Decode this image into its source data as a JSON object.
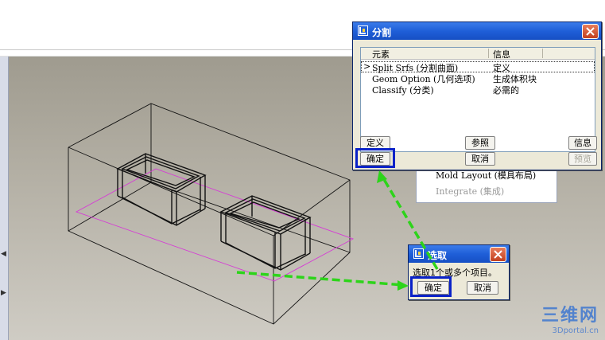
{
  "split_dialog": {
    "title": "分割",
    "columns": [
      "元素",
      "信息"
    ],
    "rows": [
      {
        "marker": ">",
        "element": "Split Srfs (分割曲面)",
        "info": "定义"
      },
      {
        "marker": "",
        "element": "Geom Option (几何选项)",
        "info": "生成体积块"
      },
      {
        "marker": "",
        "element": "Classify (分类)",
        "info": "必需的"
      }
    ],
    "buttons": {
      "define": "定义",
      "reference": "参照",
      "info": "信息",
      "ok": "确定",
      "cancel": "取消",
      "preview": "预览"
    }
  },
  "menu_behind": {
    "items": [
      "Mold Layout (模具布局)",
      "Integrate (集成)"
    ]
  },
  "select_dialog": {
    "title": "选取",
    "prompt": "选取1个或多个项目。",
    "ok": "确定",
    "cancel": "取消"
  },
  "watermark": {
    "title": "三维网",
    "url": "3Dportal.cn"
  },
  "colors": {
    "title_bar": "#1f5fd8",
    "highlight_box": "#0a22c8",
    "arrow": "#2dd41a",
    "parting_line": "#d63ad6"
  }
}
